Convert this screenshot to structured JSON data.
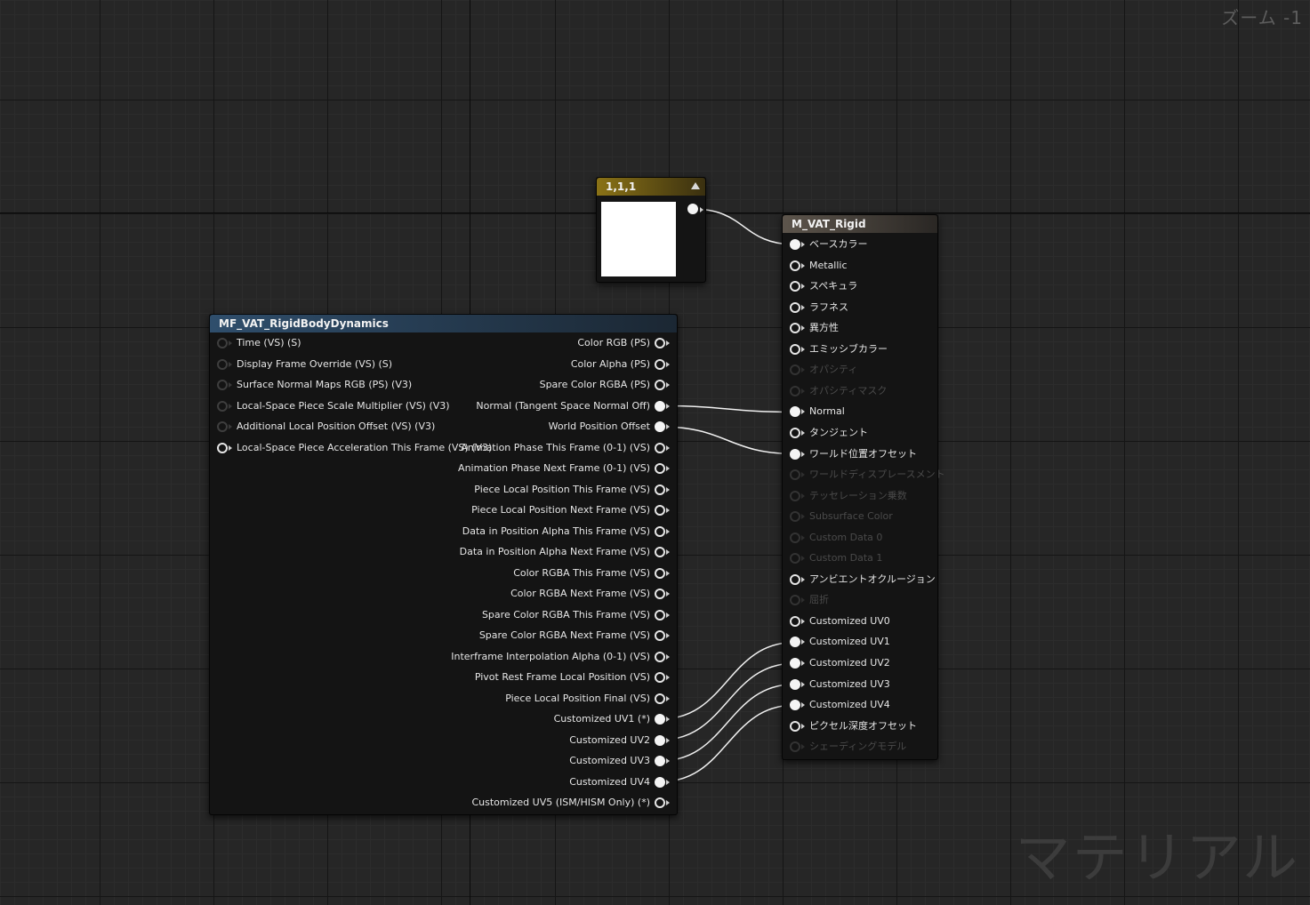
{
  "zoom_label": "ズーム -1",
  "watermark": "マテリアル",
  "constant_node": {
    "title": "1,1,1",
    "color": "#ffffff"
  },
  "function_node": {
    "title": "MF_VAT_RigidBodyDynamics",
    "inputs": [
      {
        "label": "Time (VS) (S)",
        "state": "dim"
      },
      {
        "label": "Display Frame Override (VS) (S)",
        "state": "dim"
      },
      {
        "label": "Surface Normal Maps RGB (PS) (V3)",
        "state": "dim"
      },
      {
        "label": "Local-Space Piece Scale Multiplier (VS) (V3)",
        "state": "dim"
      },
      {
        "label": "Additional Local Position Offset (VS) (V3)",
        "state": "dim"
      },
      {
        "label": "Local-Space Piece Acceleration This Frame (VS) (V3)",
        "state": "normal"
      }
    ],
    "outputs": [
      {
        "label": "Color RGB (PS)",
        "connected": false
      },
      {
        "label": "Color Alpha (PS)",
        "connected": false
      },
      {
        "label": "Spare Color RGBA (PS)",
        "connected": false
      },
      {
        "label": "Normal (Tangent Space Normal Off)",
        "connected": true
      },
      {
        "label": "World Position Offset",
        "connected": true
      },
      {
        "label": "Animation Phase This Frame (0-1) (VS)",
        "connected": false
      },
      {
        "label": "Animation Phase Next Frame (0-1) (VS)",
        "connected": false
      },
      {
        "label": "Piece Local Position This Frame (VS)",
        "connected": false
      },
      {
        "label": "Piece Local Position Next Frame (VS)",
        "connected": false
      },
      {
        "label": "Data in Position Alpha This Frame (VS)",
        "connected": false
      },
      {
        "label": "Data in Position Alpha Next Frame (VS)",
        "connected": false
      },
      {
        "label": "Color RGBA This Frame (VS)",
        "connected": false
      },
      {
        "label": "Color RGBA Next Frame (VS)",
        "connected": false
      },
      {
        "label": "Spare Color RGBA This Frame (VS)",
        "connected": false
      },
      {
        "label": "Spare Color RGBA Next Frame (VS)",
        "connected": false
      },
      {
        "label": "Interframe Interpolation Alpha (0-1) (VS)",
        "connected": false
      },
      {
        "label": "Pivot Rest Frame Local Position (VS)",
        "connected": false
      },
      {
        "label": "Piece Local Position Final (VS)",
        "connected": false
      },
      {
        "label": "Customized UV1 (*)",
        "connected": true
      },
      {
        "label": "Customized UV2",
        "connected": true
      },
      {
        "label": "Customized UV3",
        "connected": true
      },
      {
        "label": "Customized UV4",
        "connected": true
      },
      {
        "label": "Customized UV5 (ISM/HISM Only) (*)",
        "connected": false
      }
    ]
  },
  "material_node": {
    "title": "M_VAT_Rigid",
    "inputs": [
      {
        "label": "ベースカラー",
        "state": "connected"
      },
      {
        "label": "Metallic",
        "state": "normal"
      },
      {
        "label": "スペキュラ",
        "state": "normal"
      },
      {
        "label": "ラフネス",
        "state": "normal"
      },
      {
        "label": "異方性",
        "state": "normal"
      },
      {
        "label": "エミッシブカラー",
        "state": "normal"
      },
      {
        "label": "オパシティ",
        "state": "disabled"
      },
      {
        "label": "オパシティマスク",
        "state": "disabled"
      },
      {
        "label": "Normal",
        "state": "connected"
      },
      {
        "label": "タンジェント",
        "state": "normal"
      },
      {
        "label": "ワールド位置オフセット",
        "state": "connected"
      },
      {
        "label": "ワールドディスプレースメント",
        "state": "disabled"
      },
      {
        "label": "テッセレーション乗数",
        "state": "disabled"
      },
      {
        "label": "Subsurface Color",
        "state": "disabled"
      },
      {
        "label": "Custom Data 0",
        "state": "disabled"
      },
      {
        "label": "Custom Data 1",
        "state": "disabled"
      },
      {
        "label": "アンビエントオクルージョン",
        "state": "normal"
      },
      {
        "label": "屈折",
        "state": "disabled"
      },
      {
        "label": "Customized UV0",
        "state": "normal"
      },
      {
        "label": "Customized UV1",
        "state": "connected"
      },
      {
        "label": "Customized UV2",
        "state": "connected"
      },
      {
        "label": "Customized UV3",
        "state": "connected"
      },
      {
        "label": "Customized UV4",
        "state": "connected"
      },
      {
        "label": "ピクセル深度オフセット",
        "state": "normal"
      },
      {
        "label": "シェーディングモデル",
        "state": "disabled"
      }
    ]
  },
  "connections": [
    {
      "from": "constant.out",
      "to": "material.0"
    },
    {
      "from": "function.out.3",
      "to": "material.8"
    },
    {
      "from": "function.out.4",
      "to": "material.10"
    },
    {
      "from": "function.out.18",
      "to": "material.19"
    },
    {
      "from": "function.out.19",
      "to": "material.20"
    },
    {
      "from": "function.out.20",
      "to": "material.21"
    },
    {
      "from": "function.out.21",
      "to": "material.22"
    }
  ]
}
